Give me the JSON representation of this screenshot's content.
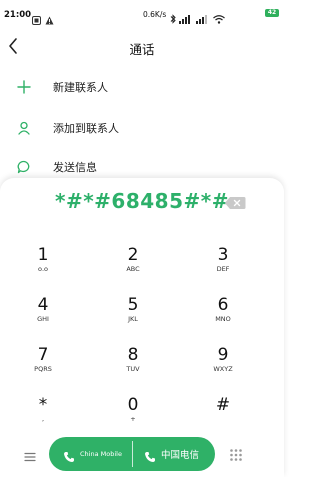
{
  "status_bar": {
    "time": "21:00",
    "network_speed": "0.6K/s",
    "battery_level": "42",
    "icons": [
      "notification-icon",
      "warning-icon",
      "bluetooth-icon",
      "signal-icon",
      "signal-icon",
      "wifi-icon",
      "battery-icon"
    ]
  },
  "header": {
    "title": "通话"
  },
  "actions": [
    {
      "label": "新建联系人",
      "icon": "plus-icon"
    },
    {
      "label": "添加到联系人",
      "icon": "person-icon"
    },
    {
      "label": "发送信息",
      "icon": "message-icon"
    }
  ],
  "dialer": {
    "number": "*#*#68485#*#",
    "keys": [
      {
        "digit": "1",
        "letters": "ᴏ.ᴏ"
      },
      {
        "digit": "2",
        "letters": "ABC"
      },
      {
        "digit": "3",
        "letters": "DEF"
      },
      {
        "digit": "4",
        "letters": "GHI"
      },
      {
        "digit": "5",
        "letters": "JKL"
      },
      {
        "digit": "6",
        "letters": "MNO"
      },
      {
        "digit": "7",
        "letters": "PQRS"
      },
      {
        "digit": "8",
        "letters": "TUV"
      },
      {
        "digit": "9",
        "letters": "WXYZ"
      },
      {
        "digit": "*",
        "letters": ","
      },
      {
        "digit": "0",
        "letters": "+"
      },
      {
        "digit": "#",
        "letters": ""
      }
    ]
  },
  "call": {
    "sim1_label": "China Mobile",
    "sim2_label": "中国电信"
  },
  "colors": {
    "accent": "#2fb167",
    "number_text": "#2db06a"
  }
}
